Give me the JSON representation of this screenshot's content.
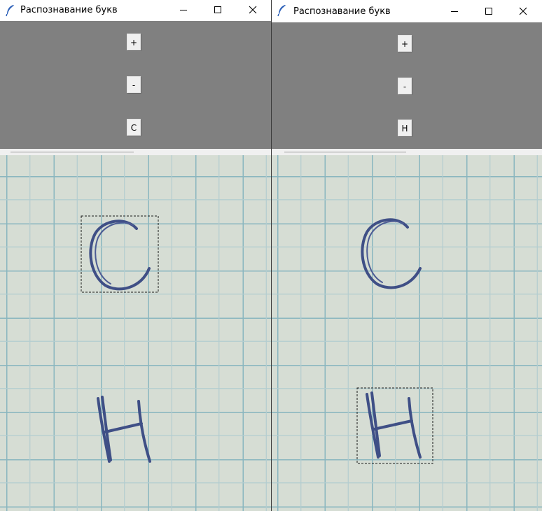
{
  "windows": [
    {
      "title": "Распознавание букв",
      "buttons": {
        "plus": "+",
        "minus": "-",
        "letter": "С"
      },
      "selected_letter": "С"
    },
    {
      "title": "Распознавание букв",
      "buttons": {
        "plus": "+",
        "minus": "-",
        "letter": "Н"
      },
      "selected_letter": "Н"
    }
  ],
  "colors": {
    "panel_bg": "#808080",
    "paper": "#d6ddd4",
    "grid": "#8ab6bf",
    "ink": "#3f4f86",
    "selection_box": "#1a1a1a"
  },
  "icons": [
    "feather-icon",
    "minimize-icon",
    "maximize-icon",
    "close-icon"
  ]
}
